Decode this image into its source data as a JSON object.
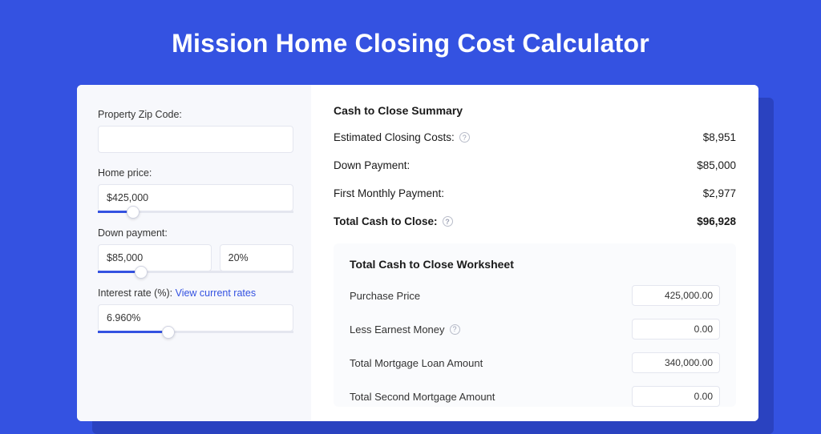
{
  "title": "Mission Home Closing Cost Calculator",
  "left": {
    "zip_label": "Property Zip Code:",
    "zip_value": "",
    "home_price_label": "Home price:",
    "home_price_value": "$425,000",
    "home_price_slider_pct": 18,
    "down_payment_label": "Down payment:",
    "down_payment_value": "$85,000",
    "down_payment_pct_value": "20%",
    "down_payment_slider_pct": 22,
    "interest_label": "Interest rate (%):",
    "interest_link": "View current rates",
    "interest_value": "6.960%",
    "interest_slider_pct": 36
  },
  "summary": {
    "heading": "Cash to Close Summary",
    "rows": [
      {
        "label": "Estimated Closing Costs:",
        "help": true,
        "value": "$8,951",
        "bold": false
      },
      {
        "label": "Down Payment:",
        "help": false,
        "value": "$85,000",
        "bold": false
      },
      {
        "label": "First Monthly Payment:",
        "help": false,
        "value": "$2,977",
        "bold": false
      },
      {
        "label": "Total Cash to Close:",
        "help": true,
        "value": "$96,928",
        "bold": true
      }
    ]
  },
  "worksheet": {
    "heading": "Total Cash to Close Worksheet",
    "rows": [
      {
        "label": "Purchase Price",
        "help": false,
        "value": "425,000.00"
      },
      {
        "label": "Less Earnest Money",
        "help": true,
        "value": "0.00"
      },
      {
        "label": "Total Mortgage Loan Amount",
        "help": false,
        "value": "340,000.00"
      },
      {
        "label": "Total Second Mortgage Amount",
        "help": false,
        "value": "0.00"
      }
    ]
  }
}
